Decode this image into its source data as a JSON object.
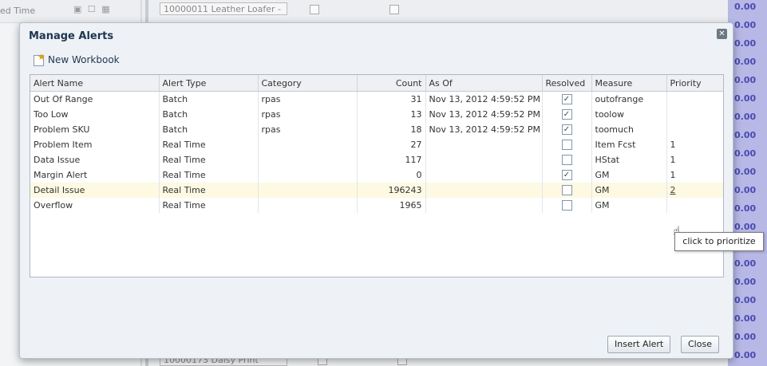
{
  "background": {
    "left_label": "ed Time",
    "sku_top": "10000011 Leather Loafer -",
    "sku_bottom": "10000173 Daisy Print",
    "values": [
      "0.00",
      "0.00",
      "0.00",
      "0.00",
      "0.00",
      "0.00",
      "0.00",
      "0.00",
      "0.00",
      "0.00",
      "0.00",
      "0.00",
      "0.00",
      "0.00",
      "0.00",
      "0.00",
      "0.00",
      "0.00",
      "0.00",
      "0.00"
    ]
  },
  "dialog": {
    "title": "Manage Alerts",
    "toolbar": {
      "new_workbook": "New Workbook"
    },
    "columns": {
      "alert_name": "Alert Name",
      "alert_type": "Alert Type",
      "category": "Category",
      "count": "Count",
      "as_of": "As Of",
      "resolved": "Resolved",
      "measure": "Measure",
      "priority": "Priority"
    },
    "rows": [
      {
        "name": "Out Of Range",
        "type": "Batch",
        "category": "rpas",
        "count": "31",
        "as_of": "Nov 13, 2012 4:59:52 PM",
        "resolved": true,
        "measure": "outofrange",
        "priority": ""
      },
      {
        "name": "Too Low",
        "type": "Batch",
        "category": "rpas",
        "count": "13",
        "as_of": "Nov 13, 2012 4:59:52 PM",
        "resolved": true,
        "measure": "toolow",
        "priority": ""
      },
      {
        "name": "Problem SKU",
        "type": "Batch",
        "category": "rpas",
        "count": "18",
        "as_of": "Nov 13, 2012 4:59:52 PM",
        "resolved": true,
        "measure": "toomuch",
        "priority": ""
      },
      {
        "name": "Problem Item",
        "type": "Real Time",
        "category": "",
        "count": "27",
        "as_of": "",
        "resolved": false,
        "measure": "Item Fcst",
        "priority": "1"
      },
      {
        "name": "Data Issue",
        "type": "Real Time",
        "category": "",
        "count": "117",
        "as_of": "",
        "resolved": false,
        "measure": "HStat",
        "priority": "1"
      },
      {
        "name": "Margin Alert",
        "type": "Real Time",
        "category": "",
        "count": "0",
        "as_of": "",
        "resolved": true,
        "measure": "GM",
        "priority": "1"
      },
      {
        "name": "Detail Issue",
        "type": "Real Time",
        "category": "",
        "count": "196243",
        "as_of": "",
        "resolved": false,
        "measure": "GM",
        "priority": "2"
      },
      {
        "name": "Overflow",
        "type": "Real Time",
        "category": "",
        "count": "1965",
        "as_of": "",
        "resolved": false,
        "measure": "GM",
        "priority": ""
      }
    ],
    "highlighted_row": 6,
    "tooltip": "click to prioritize",
    "buttons": {
      "insert_alert": "Insert Alert",
      "close": "Close"
    },
    "check_mark": "✓"
  }
}
